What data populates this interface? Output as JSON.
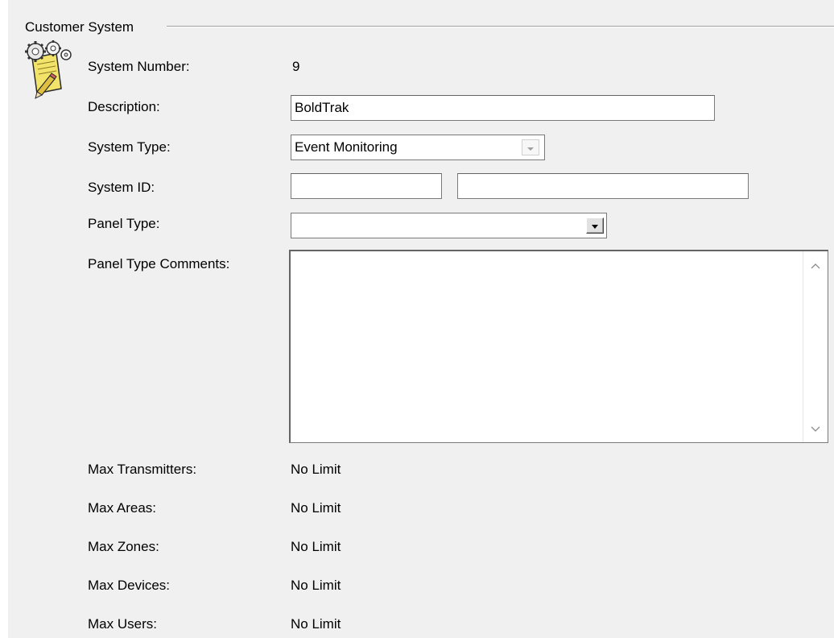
{
  "group": {
    "title": "Customer System"
  },
  "icons": {
    "system": "gear-document-pencil-icon",
    "combo_arrow": "chevron-down-icon",
    "scroll_up": "chevron-up-icon",
    "scroll_down": "chevron-down-icon"
  },
  "fields": {
    "system_number": {
      "label": "System Number:",
      "value": "9"
    },
    "description": {
      "label": "Description:",
      "value": "BoldTrak"
    },
    "system_type": {
      "label": "System Type:",
      "value": "Event Monitoring"
    },
    "system_id": {
      "label": "System ID:",
      "value_1": "",
      "value_2": ""
    },
    "panel_type": {
      "label": "Panel Type:",
      "value": ""
    },
    "panel_type_comments": {
      "label": "Panel Type Comments:",
      "value": ""
    }
  },
  "limits": [
    {
      "label": "Max Transmitters:",
      "value": "No Limit"
    },
    {
      "label": "Max Areas:",
      "value": "No Limit"
    },
    {
      "label": "Max Zones:",
      "value": "No Limit"
    },
    {
      "label": "Max Devices:",
      "value": "No Limit"
    },
    {
      "label": "Max Users:",
      "value": "No Limit"
    }
  ],
  "colors": {
    "window_background": "#f0f0f0",
    "field_background": "#ffffff",
    "field_border": "#7a7a7a"
  }
}
